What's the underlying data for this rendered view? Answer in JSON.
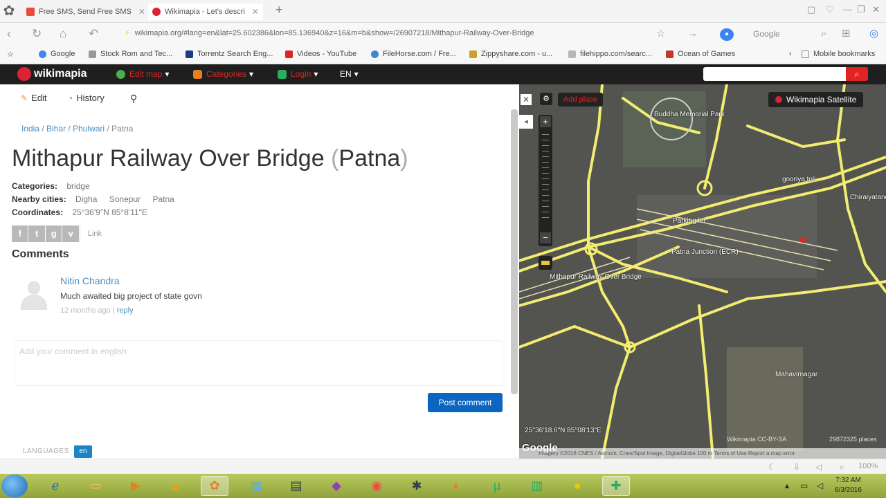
{
  "browser": {
    "tabs": [
      {
        "label": "Free SMS, Send Free SMS",
        "icon": "way2sms-icon",
        "color": "#e74c3c"
      },
      {
        "label": "Wikimapia - Let's descri",
        "icon": "wikimapia-icon",
        "color": "#d23"
      }
    ],
    "url": "wikimapia.org/#lang=en&lat=25.602386&lon=85.136940&z=16&m=b&show=/26907218/Mithapur-Railway-Over-Bridge",
    "search_engine": "Google",
    "bookmarks": [
      {
        "label": "Google",
        "color": "#4285f4"
      },
      {
        "label": "Stock Rom and Tec...",
        "color": "#999"
      },
      {
        "label": "Torrentz Search Eng...",
        "color": "#1a3a8a"
      },
      {
        "label": "Videos - YouTube",
        "color": "#e02424"
      },
      {
        "label": "FileHorse.com / Fre...",
        "color": "#3a8ad6"
      },
      {
        "label": "Zippyshare.com - u...",
        "color": "#c9a227"
      },
      {
        "label": "filehippo.com/searc...",
        "color": "#b7b7b7"
      },
      {
        "label": "Ocean of Games",
        "color": "#c0392b"
      }
    ],
    "mobile_bookmarks": "Mobile bookmarks"
  },
  "wikimapia": {
    "logo": "wikimapia",
    "menu": [
      {
        "label": "Edit map",
        "color": "#4caf50"
      },
      {
        "label": "Categories",
        "color": "#e67e22"
      },
      {
        "label": "Login",
        "color": "#27ae60"
      },
      {
        "label": "EN",
        "color": "#ffffff"
      }
    ]
  },
  "place": {
    "toolbar": {
      "edit": "Edit",
      "history": "History"
    },
    "breadcrumb": [
      "India",
      "Bihar",
      "Phulwari",
      "Patna"
    ],
    "title": "Mithapur Railway Over Bridge",
    "title_city": "Patna",
    "categories_label": "Categories:",
    "categories_value": "bridge",
    "nearby_label": "Nearby cities:",
    "nearby": [
      "Digha",
      "Sonepur",
      "Patna"
    ],
    "coords_label": "Coordinates:",
    "coords_value": "25°36'9\"N 85°8'11\"E",
    "share_link": "Link"
  },
  "comments": {
    "heading": "Comments",
    "items": [
      {
        "author": "Nitin Chandra",
        "text": "Much awaited big project of state govn",
        "time": "12 months ago",
        "reply": "reply"
      }
    ],
    "placeholder": "Add your comment in english",
    "post_button": "Post comment",
    "languages_label": "LANGUAGES",
    "language": "en"
  },
  "map": {
    "add_place": "Add place",
    "layer_button": "Wikimapia Satellite",
    "labels": [
      {
        "text": "Buddha Memorial Park"
      },
      {
        "text": "gooriya toli"
      },
      {
        "text": "Chiraiyatand"
      },
      {
        "text": "Parking lot"
      },
      {
        "text": "Patna Junction (ECR)"
      },
      {
        "text": "Mithapur Railway Over Bridge"
      },
      {
        "text": "Mahavirnagar"
      }
    ],
    "coord_readout": "25°36'18.6\"N 85°08'13\"E",
    "google_logo": "Google",
    "attribution": "Wikimapia CC-BY-SA",
    "places_count": "29872325 places",
    "footer": "Imagery ©2016 CNES / Astrium, Cnes/Spot Image, DigitalGlobe   100 m   Terms of Use   Report a map error"
  },
  "status": {
    "zoom": "100%"
  },
  "taskbar": {
    "time": "7:32 AM",
    "date": "6/3/2016"
  }
}
